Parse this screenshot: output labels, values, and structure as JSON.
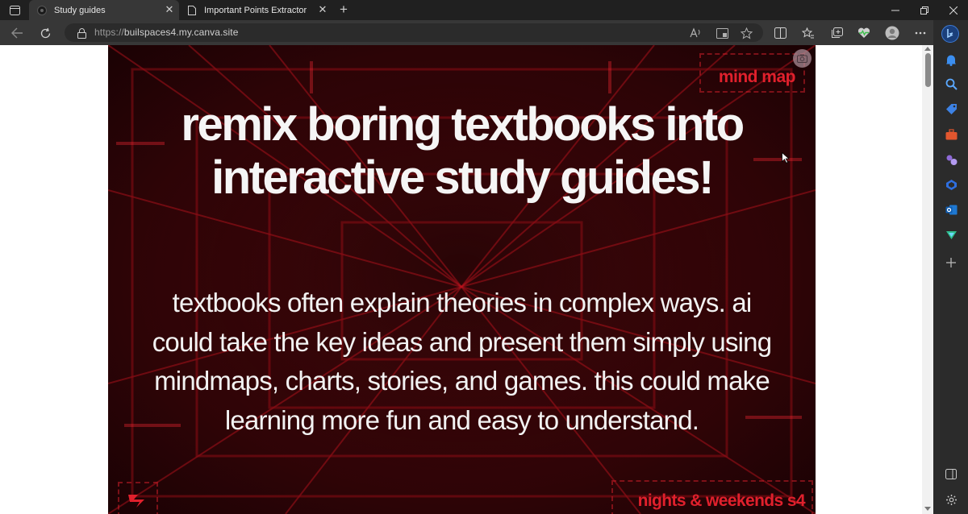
{
  "tabs": [
    {
      "title": "Study guides",
      "active": true,
      "favicon": "canva-favicon"
    },
    {
      "title": "Important Points Extractor",
      "active": false,
      "favicon": "page-icon"
    }
  ],
  "address_bar": {
    "protocol": "https://",
    "host": "builspaces4.my.canva.site"
  },
  "page": {
    "badge_top": "mind map",
    "headline": "remix boring textbooks into interactive study guides!",
    "body": "textbooks often explain theories in complex ways. ai could take the key ideas and present them simply using mindmaps, charts, stories, and games. this could make learning more fun and easy to understand.",
    "badge_bottom": "nights & weekends s4"
  },
  "colors": {
    "accent_red": "#e0202c",
    "hero_bg": "#3a0508",
    "chrome_dark": "#202020",
    "toolbar": "#373737"
  },
  "sidebar_icons": [
    "bell-icon",
    "search-icon",
    "tag-icon",
    "toolbox-icon",
    "games-icon",
    "copilot-icon",
    "outlook-icon",
    "send-icon",
    "add-icon",
    "split-screen-icon",
    "settings-icon"
  ]
}
